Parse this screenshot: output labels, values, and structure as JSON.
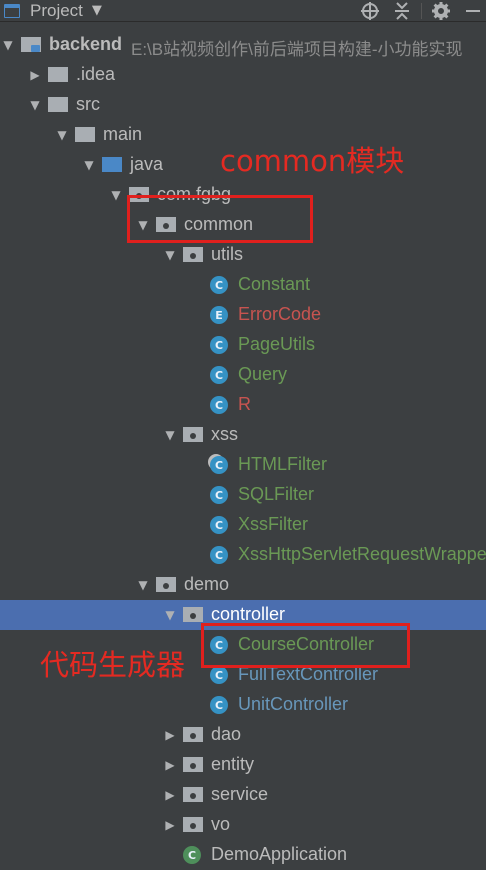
{
  "toolbar": {
    "title": "Project",
    "icons": [
      "project-view-icon",
      "dropdown-caret-icon",
      "locate-icon",
      "collapse-icon",
      "settings-icon",
      "hide-icon"
    ]
  },
  "colors": {
    "background": "#3c3f41",
    "selection": "#4b6eaf",
    "text_default": "#bbbbbb",
    "text_green": "#6a9955",
    "text_red": "#c75450",
    "text_blue": "#6897bb",
    "class_icon": "#3592c4",
    "enum_icon": "#3592c4",
    "annotation_red": "#e0201d"
  },
  "tree": {
    "rows": [
      {
        "depth": 0,
        "arrow": "down",
        "icon": "module-folder",
        "label": "backend",
        "bold": true,
        "path": "E:\\B站视频创作\\前后端项目构建-小功能实现"
      },
      {
        "depth": 1,
        "arrow": "right",
        "icon": "folder",
        "label": ".idea"
      },
      {
        "depth": 1,
        "arrow": "down",
        "icon": "folder",
        "label": "src"
      },
      {
        "depth": 2,
        "arrow": "down",
        "icon": "folder",
        "label": "main"
      },
      {
        "depth": 3,
        "arrow": "down",
        "icon": "source-folder",
        "label": "java"
      },
      {
        "depth": 4,
        "arrow": "down",
        "icon": "package",
        "label": "com.fgbg"
      },
      {
        "depth": 5,
        "arrow": "down",
        "icon": "package",
        "label": "common"
      },
      {
        "depth": 6,
        "arrow": "down",
        "icon": "package",
        "label": "utils"
      },
      {
        "depth": 7,
        "icon": "class",
        "label": "Constant",
        "color": "green"
      },
      {
        "depth": 7,
        "icon": "enum",
        "label": "ErrorCode",
        "color": "red"
      },
      {
        "depth": 7,
        "icon": "class",
        "label": "PageUtils",
        "color": "green"
      },
      {
        "depth": 7,
        "icon": "class",
        "label": "Query",
        "color": "green"
      },
      {
        "depth": 7,
        "icon": "class",
        "label": "R",
        "color": "red"
      },
      {
        "depth": 6,
        "arrow": "down",
        "icon": "package",
        "label": "xss"
      },
      {
        "depth": 7,
        "icon": "class-modified",
        "label": "HTMLFilter",
        "color": "green"
      },
      {
        "depth": 7,
        "icon": "class",
        "label": "SQLFilter",
        "color": "green"
      },
      {
        "depth": 7,
        "icon": "class",
        "label": "XssFilter",
        "color": "green"
      },
      {
        "depth": 7,
        "icon": "class",
        "label": "XssHttpServletRequestWrapper",
        "color": "green"
      },
      {
        "depth": 5,
        "arrow": "down",
        "icon": "package",
        "label": "demo"
      },
      {
        "depth": 6,
        "arrow": "down",
        "icon": "package",
        "label": "controller",
        "selected": true
      },
      {
        "depth": 7,
        "icon": "class",
        "label": "CourseController",
        "color": "green"
      },
      {
        "depth": 7,
        "icon": "class",
        "label": "FullTextController",
        "color": "blue"
      },
      {
        "depth": 7,
        "icon": "class",
        "label": "UnitController",
        "color": "blue"
      },
      {
        "depth": 6,
        "arrow": "right",
        "icon": "package",
        "label": "dao"
      },
      {
        "depth": 6,
        "arrow": "right",
        "icon": "package",
        "label": "entity"
      },
      {
        "depth": 6,
        "arrow": "right",
        "icon": "package",
        "label": "service"
      },
      {
        "depth": 6,
        "arrow": "right",
        "icon": "package",
        "label": "vo"
      },
      {
        "depth": 6,
        "icon": "spring-boot-class",
        "label": "DemoApplication"
      }
    ]
  },
  "annotations": {
    "common_label": "common模块",
    "generator_label": "代码生成器"
  }
}
